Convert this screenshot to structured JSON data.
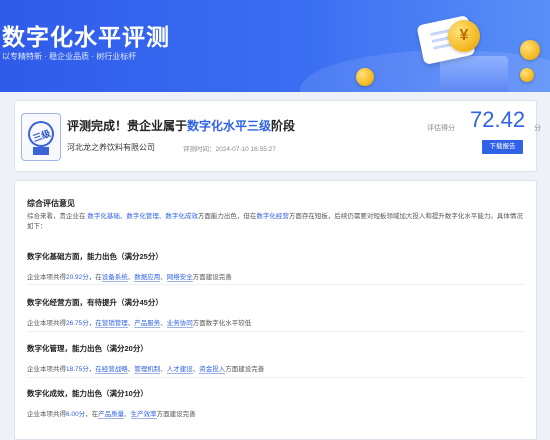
{
  "banner": {
    "title": "数字化水平评测",
    "subtitle": "以专精特新 · 稳企业品质 · 树行业标杆",
    "coin_symbol": "¥"
  },
  "result": {
    "prefix": "评测完成！贵企业属于",
    "level": "数字化水平三级",
    "suffix": "阶段",
    "company": "河北龙之养饮料有限公司",
    "time_label": "评测时间：",
    "time_value": "2024-07-10 16:55:27",
    "badge_text": "三级",
    "score_label": "评估得分",
    "score": "72.42",
    "score_unit": "分",
    "download_label": "下载报告"
  },
  "opinion": {
    "title": "综合评估意见",
    "summary_parts": [
      {
        "t": "综合来看，贵企业在 ",
        "hl": false
      },
      {
        "t": "数字化基础、数字化管理、数字化成效",
        "hl": true
      },
      {
        "t": "方面能力出色，但在",
        "hl": false
      },
      {
        "t": "数字化经营",
        "hl": true
      },
      {
        "t": "方面存在短板，后续仍需要对短板领域加大投入和提升数字化水平能力。具体情况如下：",
        "hl": false
      }
    ],
    "items": [
      {
        "head": "数字化基础方面，能力出色（满分25分）",
        "desc_prefix": "企业本项共得",
        "score": "20.92分",
        "desc_mid": "，在",
        "tags": [
          "设备系统",
          "数据应用",
          "网络安全"
        ],
        "desc_suffix": "方面建设完善"
      },
      {
        "head": "数字化经营方面，有待提升（满分45分）",
        "desc_prefix": "企业本项共得",
        "score": "26.75分",
        "desc_mid": "，",
        "tags": [
          "在营销管理",
          "产品服务",
          "业务协同"
        ],
        "desc_suffix": "方面数字化水平较低"
      },
      {
        "head": "数字化管理，能力出色（满分20分）",
        "desc_prefix": "企业本项共得",
        "score": "18.75分",
        "desc_mid": "，",
        "tags": [
          "在经营战略",
          "管理机制",
          "人才建设",
          "资金投入"
        ],
        "desc_suffix": "方面建设完善"
      },
      {
        "head": "数字化成效，能力出色（满分10分）",
        "desc_prefix": "企业本项共得",
        "score": "6.00分",
        "desc_mid": "，在",
        "tags": [
          "产品质量",
          "生产效率"
        ],
        "desc_suffix": "方面建设完善"
      }
    ]
  },
  "colors": {
    "accent": "#2f62e6",
    "banner_start": "#2f5bea",
    "banner_end": "#5a8ff7"
  }
}
